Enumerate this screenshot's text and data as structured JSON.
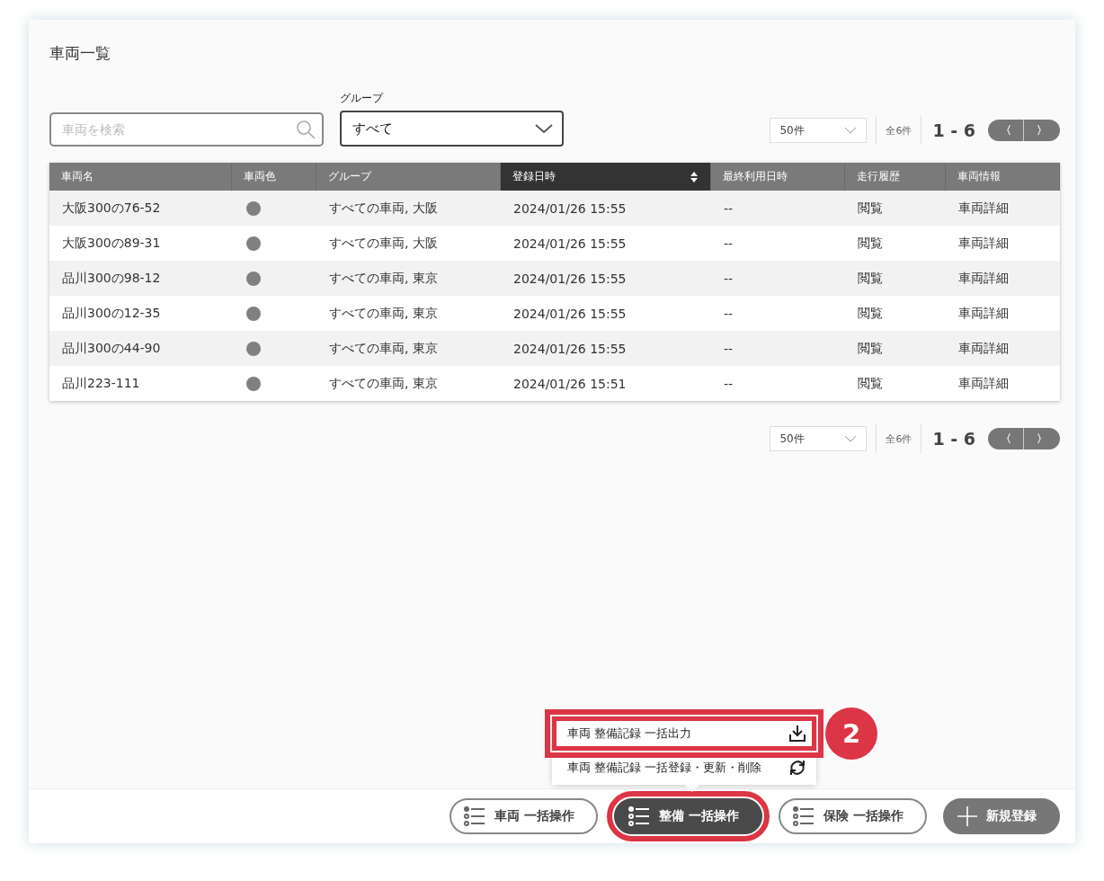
{
  "title": "車両一覧",
  "search": {
    "placeholder": "車両を検索"
  },
  "group_filter": {
    "label": "グループ",
    "value": "すべて"
  },
  "pagination_top": {
    "per_page": "50件",
    "total": "全6件",
    "range": "1 - 6",
    "prev": "〈",
    "next": "〉"
  },
  "table": {
    "columns": [
      {
        "label": "車両名",
        "sorted": false
      },
      {
        "label": "車両色",
        "sorted": false
      },
      {
        "label": "グループ",
        "sorted": false
      },
      {
        "label": "登録日時",
        "sorted": true
      },
      {
        "label": "最終利用日時",
        "sorted": false
      },
      {
        "label": "走行履歴",
        "sorted": false
      },
      {
        "label": "車両情報",
        "sorted": false
      }
    ],
    "rows": [
      {
        "name": "大阪300の76-52",
        "color": "#808080",
        "group": "すべての車両, 大阪",
        "registered": "2024/01/26 15:55",
        "last_used": "--",
        "history": "閲覧",
        "info": "車両詳細"
      },
      {
        "name": "大阪300の89-31",
        "color": "#808080",
        "group": "すべての車両, 大阪",
        "registered": "2024/01/26 15:55",
        "last_used": "--",
        "history": "閲覧",
        "info": "車両詳細"
      },
      {
        "name": "品川300の98-12",
        "color": "#808080",
        "group": "すべての車両, 東京",
        "registered": "2024/01/26 15:55",
        "last_used": "--",
        "history": "閲覧",
        "info": "車両詳細"
      },
      {
        "name": "品川300の12-35",
        "color": "#808080",
        "group": "すべての車両, 東京",
        "registered": "2024/01/26 15:55",
        "last_used": "--",
        "history": "閲覧",
        "info": "車両詳細"
      },
      {
        "name": "品川300の44-90",
        "color": "#808080",
        "group": "すべての車両, 東京",
        "registered": "2024/01/26 15:55",
        "last_used": "--",
        "history": "閲覧",
        "info": "車両詳細"
      },
      {
        "name": "品川223-111",
        "color": "#808080",
        "group": "すべての車両, 東京",
        "registered": "2024/01/26 15:51",
        "last_used": "--",
        "history": "閲覧",
        "info": "車両詳細"
      }
    ]
  },
  "pagination_bottom": {
    "per_page": "50件",
    "total": "全6件",
    "range": "1 - 6",
    "prev": "〈",
    "next": "〉"
  },
  "menu": {
    "items": [
      {
        "label": "車両 整備記録 一括出力",
        "kind": "download",
        "highlighted": true
      },
      {
        "label": "車両 整備記録 一括登録・更新・削除",
        "kind": "sync",
        "highlighted": false
      }
    ]
  },
  "badge": "2",
  "actions": [
    {
      "label": "車両 一括操作",
      "kind": "list",
      "active": false,
      "highlighted": false
    },
    {
      "label": "整備 一括操作",
      "kind": "list",
      "active": true,
      "highlighted": true
    },
    {
      "label": "保険 一括操作",
      "kind": "list",
      "active": false,
      "highlighted": false
    },
    {
      "label": "新規登録",
      "kind": "add",
      "active": false,
      "highlighted": false
    }
  ]
}
